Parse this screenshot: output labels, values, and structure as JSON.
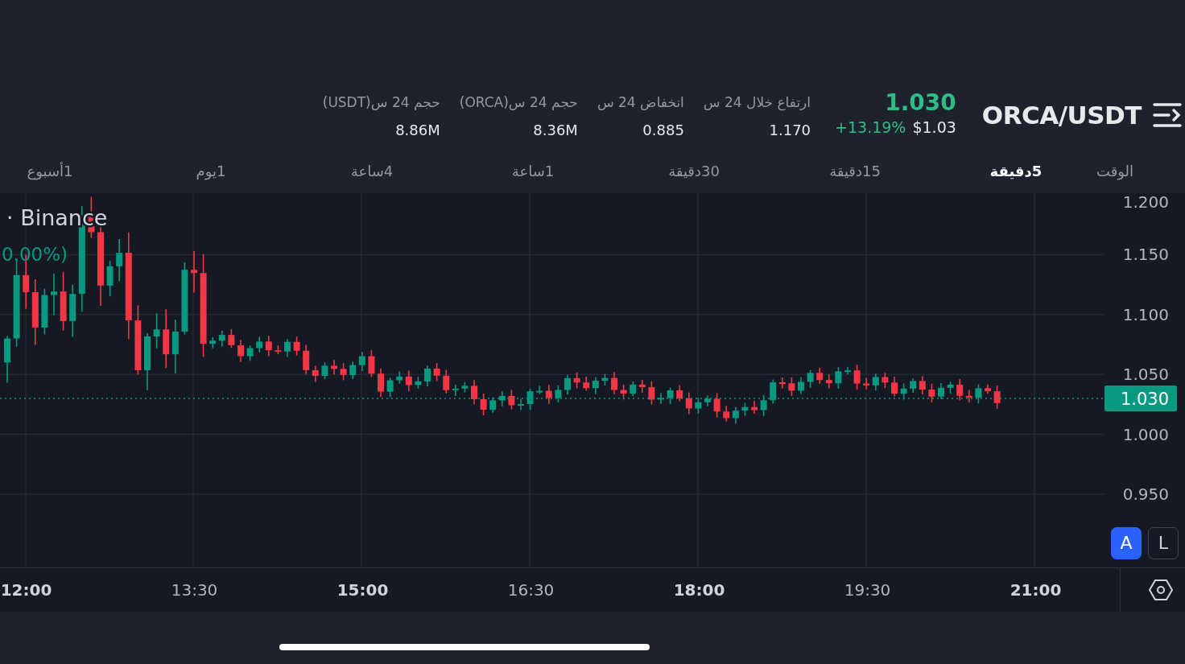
{
  "header": {
    "pair": "ORCA/USDT",
    "last_price": "1.030",
    "change": "+13.19%",
    "price_usd": "$1.03",
    "stats": [
      {
        "label": "ارتفاع خلال 24 س",
        "value": "1.170"
      },
      {
        "label": "انخفاض 24 س",
        "value": "0.885"
      },
      {
        "label": "حجم 24 س(ORCA)",
        "value": "8.36M"
      },
      {
        "label": "حجم 24 س(USDT)",
        "value": "8.86M"
      }
    ]
  },
  "intervals": [
    {
      "label": "الوقت",
      "selected": false
    },
    {
      "label": "5دقيقة",
      "selected": true
    },
    {
      "label": "15دقيقة",
      "selected": false
    },
    {
      "label": "30دقيقة",
      "selected": false
    },
    {
      "label": "1ساعة",
      "selected": false
    },
    {
      "label": "4ساعة",
      "selected": false
    },
    {
      "label": "1يوم",
      "selected": false
    },
    {
      "label": "1أسبوع",
      "selected": false
    }
  ],
  "chart": {
    "legend": {
      "exchange": "· Binance",
      "change": "0.00%)"
    },
    "price_ticks": [
      "1.200",
      "1.150",
      "1.100",
      "1.050",
      "1.000",
      "0.950"
    ],
    "current_price": "1.030",
    "time_ticks": [
      {
        "label": "21:00",
        "major": true
      },
      {
        "label": "19:30",
        "major": false
      },
      {
        "label": "18:00",
        "major": true
      },
      {
        "label": "16:30",
        "major": false
      },
      {
        "label": "15:00",
        "major": true
      },
      {
        "label": "13:30",
        "major": false
      },
      {
        "label": "12:00",
        "major": true
      }
    ],
    "scale_buttons": [
      {
        "label": "L",
        "selected": false
      },
      {
        "label": "A",
        "selected": true
      }
    ]
  }
}
